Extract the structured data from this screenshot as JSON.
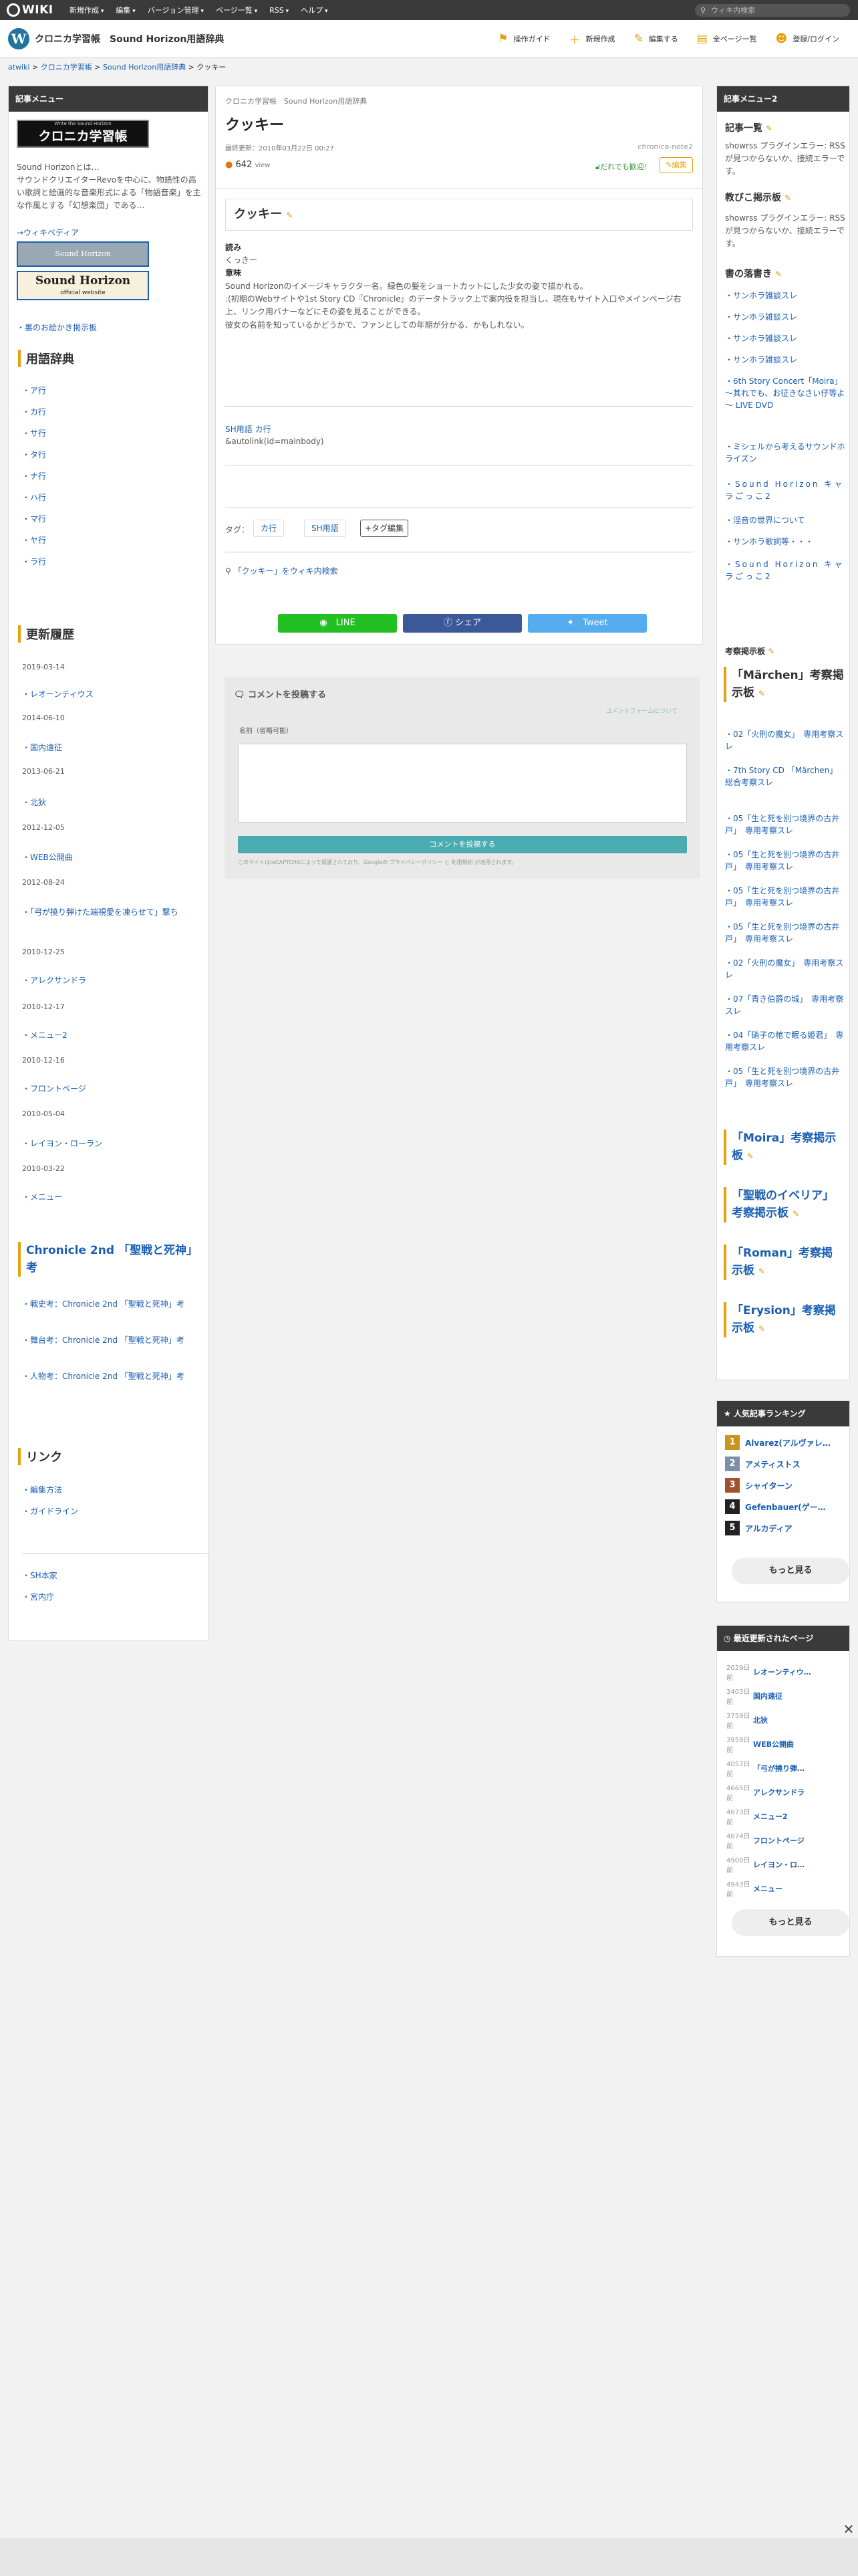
{
  "topbar": {
    "logo": "WIKI",
    "menu": [
      "新規作成",
      "編集",
      "バージョン管理",
      "ページ一覧",
      "RSS",
      "ヘルプ"
    ],
    "search_placeholder": "ウィキ内検索"
  },
  "header": {
    "wiki_name": "クロニカ学習帳",
    "sub_name": "Sound Horizon用語辞典",
    "tools": [
      "操作ガイド",
      "新規作成",
      "編集する",
      "全ページ一覧",
      "登録/ログイン"
    ]
  },
  "breadcrumb": {
    "items": [
      "atwiki",
      "クロニカ学習帳",
      "Sound Horizon用語辞典"
    ],
    "current": "クッキー"
  },
  "left": {
    "head": "記事メニュー",
    "logo_text": "クロニカ学習帳",
    "logo_sub": "Write the Sound Horizon",
    "intro": "Sound Horizonとは…\nサウンドクリエイターRevoを中心に、物語性の高い歌詞と絵画的な音楽形式による「物語音楽」を主な作風とする「幻想楽団」である…",
    "wiki_link": "→ウィキペディア",
    "banner1": "Sound Horizon",
    "banner2": "Sound Horizon",
    "banner2_sub": "official website",
    "board": "裏のお絵かき掲示板",
    "dict_title": "用語辞典",
    "dict_items": [
      "ア行",
      "カ行",
      "サ行",
      "タ行",
      "ナ行",
      "ハ行",
      "マ行",
      "ヤ行",
      "ラ行"
    ],
    "history_title": "更新履歴",
    "history": [
      {
        "date": "2019-03-14",
        "items": [
          "レオーンティウス"
        ]
      },
      {
        "date": "2014-06-10",
        "items": [
          "国内遠征"
        ]
      },
      {
        "date": "2013-06-21",
        "items": [
          "北狄"
        ]
      },
      {
        "date": "2012-12-05",
        "items": [
          "WEB公開曲"
        ]
      },
      {
        "date": "2012-08-24",
        "items": [
          "「弓が撓り弾けた端視愛を凍らせて」撃ち"
        ]
      },
      {
        "date": "2010-12-25",
        "items": [
          "アレクサンドラ"
        ]
      },
      {
        "date": "2010-12-17",
        "items": [
          "メニュー2"
        ]
      },
      {
        "date": "2010-12-16",
        "items": [
          "フロントページ"
        ]
      },
      {
        "date": "2010-05-04",
        "items": [
          "レイヨン・ローラン"
        ]
      },
      {
        "date": "2010-03-22",
        "items": [
          "メニュー"
        ]
      }
    ],
    "chronicle_title": "Chronicle 2nd 「聖戦と死神」考",
    "chronicle_items": [
      "戦史考：Chronicle 2nd 「聖戦と死神」考",
      "舞台考：Chronicle 2nd 「聖戦と死神」考",
      "人物考：Chronicle 2nd 「聖戦と死神」考"
    ],
    "link_title": "リンク",
    "link_items": [
      "編集方法",
      "ガイドライン"
    ],
    "extra_items": [
      "SH本家",
      "宮内庁"
    ]
  },
  "article": {
    "crumb": "クロニカ学習帳　Sound Horizon用語辞典",
    "title": "クッキー",
    "updated": "最終更新：2010年03月22日 00:27",
    "author": "chronica-note2",
    "views": "642",
    "views_unit": "view",
    "anyone": "だれでも歓迎！",
    "edit": "編集",
    "heading": "クッキー",
    "reading_label": "読み",
    "reading": "くっきー",
    "meaning_label": "意味",
    "meaning1": "Sound Horizonのイメージキャラクター名。緑色の髪をショートカットにした少女の姿で描かれる。",
    "meaning2": ":(初期のWebサイトや1st Story CD『Chronicle』のデータトラック上で案内役を担当し、現在もサイト入口やメインページ右上、リンク用バナーなどにその姿を見ることができる。",
    "meaning3": "彼女の名前を知っているかどうかで、ファンとしての年期が分かる、かもしれない。",
    "category": "SH用語 カ行",
    "autolink": "&autolink(id=mainbody)",
    "tag_label": "タグ：",
    "tags": [
      "カ行",
      "SH用語"
    ],
    "tag_edit": "+タグ編集",
    "search_wiki": "「クッキー」をウィキ内検索",
    "share": [
      "LINE",
      "シェア",
      "Tweet"
    ]
  },
  "comment": {
    "title": "コメントを投稿する",
    "notice": "コメントフォームについて",
    "name_label": "名前（省略可能）",
    "submit": "コメントを投稿する",
    "recaptcha": "このサイトはreCAPTCHAによって保護されており、Googleの プライバシーポリシー と 利用規約 が適用されます。"
  },
  "right": {
    "head": "記事メニュー2",
    "list_title": "記事一覧",
    "rss_error": "showrss プラグインエラー: RSSが見つからないか、接続エラーです。",
    "board_title": "教びこ掲示板",
    "rss_error2": "showrss プラグインエラー: RSSが見つからないか、接続エラーです。",
    "books_title": "書の落書き",
    "books": [
      "サンホラ雑談スレ",
      "サンホラ雑談スレ",
      "サンホラ雑談スレ",
      "サンホラ雑談スレ",
      "6th Story Concert「Moira」～其れでも、お征きなさい仔等よ～ LIVE DVD",
      "ミシェルから考えるサウンドホライズン",
      "Sound Horizon キャラごっこ2",
      "淫音の世界について",
      "サンホラ歌詞等・・・",
      "Sound Horizon キャラごっこ2"
    ],
    "consider_title": "考察掲示板",
    "marchen_title": "「Märchen」考察掲示板",
    "marchen_items": [
      "02「火刑の魔女」　専用考察スレ",
      "7th Story CD 「Märchen」総合考察スレ",
      "05「生と死を別つ境界の古井戸」　専用考察スレ",
      "05「生と死を別つ境界の古井戸」　専用考察スレ",
      "05「生と死を別つ境界の古井戸」　専用考察スレ",
      "05「生と死を別つ境界の古井戸」　専用考察スレ",
      "02「火刑の魔女」　専用考察スレ",
      "07「青き伯爵の城」　専用考察スレ",
      "04「硝子の棺で眠る姫君」　専用考察スレ",
      "05「生と死を別つ境界の古井戸」　専用考察スレ"
    ],
    "boards": [
      "「Moira」考察掲示板",
      "「聖戦のイベリア」考察掲示板",
      "「Roman」考察掲示板",
      "「Erysion」考察掲示板"
    ],
    "ranking_title": "人気記事ランキング",
    "ranking": [
      {
        "no": "1",
        "name": "Alvarez(アルヴァレ…",
        "color": "#c8961e"
      },
      {
        "no": "2",
        "name": "アメティストス",
        "color": "#7b8fa6"
      },
      {
        "no": "3",
        "name": "シャイターン",
        "color": "#a0522d"
      },
      {
        "no": "4",
        "name": "Gefenbauer(ゲー…",
        "color": "#222222"
      },
      {
        "no": "5",
        "name": "アルカディア",
        "color": "#222222"
      }
    ],
    "more": "もっと見る",
    "recent_title": "最近更新されたページ",
    "recent": [
      {
        "ago": "2029日前",
        "name": "レオーンティウ…"
      },
      {
        "ago": "3403日前",
        "name": "国内遠征"
      },
      {
        "ago": "3759日前",
        "name": "北狄"
      },
      {
        "ago": "3959日前",
        "name": "WEB公開曲"
      },
      {
        "ago": "4057日前",
        "name": "「弓が撓り弾…"
      },
      {
        "ago": "4665日前",
        "name": "アレクサンドラ"
      },
      {
        "ago": "4673日前",
        "name": "メニュー2"
      },
      {
        "ago": "4674日前",
        "name": "フロントページ"
      },
      {
        "ago": "4900日前",
        "name": "レイヨン・ロ…"
      },
      {
        "ago": "4943日前",
        "name": "メニュー"
      }
    ],
    "more2": "もっと見る"
  }
}
